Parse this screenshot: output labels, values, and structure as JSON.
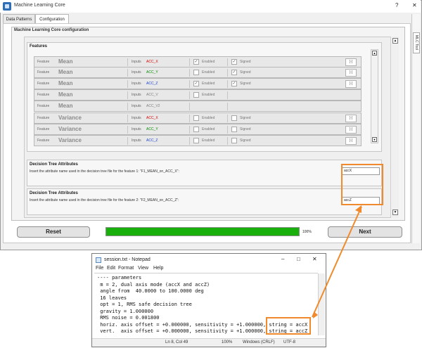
{
  "window": {
    "title": "Machine Learning Core",
    "help_glyph": "?",
    "close_glyph": "✕"
  },
  "tabs": [
    {
      "label": "Data Patterns"
    },
    {
      "label": "Configuration"
    }
  ],
  "side_tab": {
    "label": "MLC Tool"
  },
  "config": {
    "title": "Machine Learning Core configuration",
    "features_title": "Features",
    "features": [
      {
        "feature_label": "Feature",
        "name": "Mean",
        "input_label": "Inputs",
        "input": "ACC_X",
        "input_color": "#d40000",
        "enabled_label": "Enabled",
        "enabled": true,
        "signed_label": "Signed",
        "signed": true,
        "action": "[-]"
      },
      {
        "feature_label": "Feature",
        "name": "Mean",
        "input_label": "Inputs",
        "input": "ACC_Y",
        "input_color": "#008a00",
        "enabled_label": "Enabled",
        "enabled": false,
        "signed_label": "Signed",
        "signed": true,
        "action": "[-]"
      },
      {
        "feature_label": "Feature",
        "name": "Mean",
        "input_label": "Inputs",
        "input": "ACC_Z",
        "input_color": "#1c3fd1",
        "enabled_label": "Enabled",
        "enabled": true,
        "signed_label": "Signed",
        "signed": true,
        "action": "[-]"
      },
      {
        "feature_label": "Feature",
        "name": "Mean",
        "input_label": "Inputs",
        "input": "ACC_V",
        "input_color": "#808080",
        "enabled_label": "Enabled",
        "enabled": false,
        "signed_label": "",
        "signed": null,
        "action": ""
      },
      {
        "feature_label": "Feature",
        "name": "Mean",
        "input_label": "Inputs",
        "input": "ACC_V2",
        "input_color": "#808080",
        "enabled_label": "",
        "enabled": null,
        "signed_label": "",
        "signed": null,
        "action": ""
      },
      {
        "feature_label": "Feature",
        "name": "Variance",
        "input_label": "Inputs",
        "input": "ACC_X",
        "input_color": "#d40000",
        "enabled_label": "Enabled",
        "enabled": false,
        "signed_label": "Signed",
        "signed": false,
        "action": "[-]"
      },
      {
        "feature_label": "Feature",
        "name": "Variance",
        "input_label": "Inputs",
        "input": "ACC_Y",
        "input_color": "#008a00",
        "enabled_label": "Enabled",
        "enabled": false,
        "signed_label": "Signed",
        "signed": false,
        "action": "[-]"
      },
      {
        "feature_label": "Feature",
        "name": "Variance",
        "input_label": "Inputs",
        "input": "ACC_Z",
        "input_color": "#1c3fd1",
        "enabled_label": "Enabled",
        "enabled": false,
        "signed_label": "Signed",
        "signed": false,
        "action": "[-]"
      }
    ],
    "decision_trees": [
      {
        "title": "Decision Tree Attributes",
        "description": "Insert the attribute name used in the decision tree file for the feature 1: \"F1_MEAN_on_ACC_X\":",
        "value": "accX"
      },
      {
        "title": "Decision Tree Attributes",
        "description": "Insert the attribute name used in the decision tree file for the feature 2: \"F2_MEAN_on_ACC_Z\":",
        "value": "accZ"
      }
    ]
  },
  "bottom": {
    "reset_label": "Reset",
    "next_label": "Next",
    "progress": 100,
    "progress_text": "100%"
  },
  "notepad": {
    "title": "session.txt - Notepad",
    "menu": [
      "File",
      "Edit",
      "Format",
      "View",
      "Help"
    ],
    "lines": [
      "---- parameters",
      " m = 2, dual axis mode (accX and accZ)",
      " angle from  40.0000 to 100.0000 deg",
      " 16 leaves",
      " opt = 1, RMS safe decision tree",
      " gravity = 1.000000",
      " RMS noise = 0.001800",
      " horiz. axis offset = +0.000000, sensitivity = +1.000000, string = accX",
      " vert.  axis offset = +0.000000, sensitivity = +1.000000, string = accZ"
    ],
    "status": {
      "position": "Ln 8, Col 49",
      "zoom": "100%",
      "line_ending": "Windows (CRLF)",
      "encoding": "UTF-8"
    }
  },
  "colors": {
    "progress": "#19b00e",
    "highlight": "#f08a2c"
  }
}
